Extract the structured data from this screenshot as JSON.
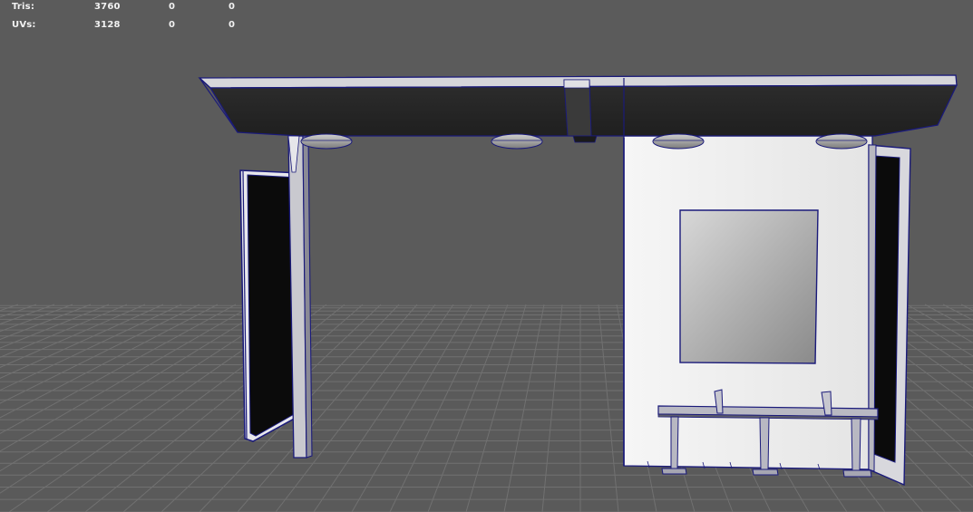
{
  "heads_up_display": {
    "rows": [
      {
        "label": "Tris:",
        "values": [
          "3760",
          "0",
          "0"
        ]
      },
      {
        "label": "UVs:",
        "values": [
          "3128",
          "0",
          "0"
        ]
      }
    ]
  },
  "viewport": {
    "background_color": "#5b5b5b",
    "grid_color": "#6e6e6e",
    "wireframe_color": "#1a1a7a",
    "model": "bus-shelter"
  }
}
